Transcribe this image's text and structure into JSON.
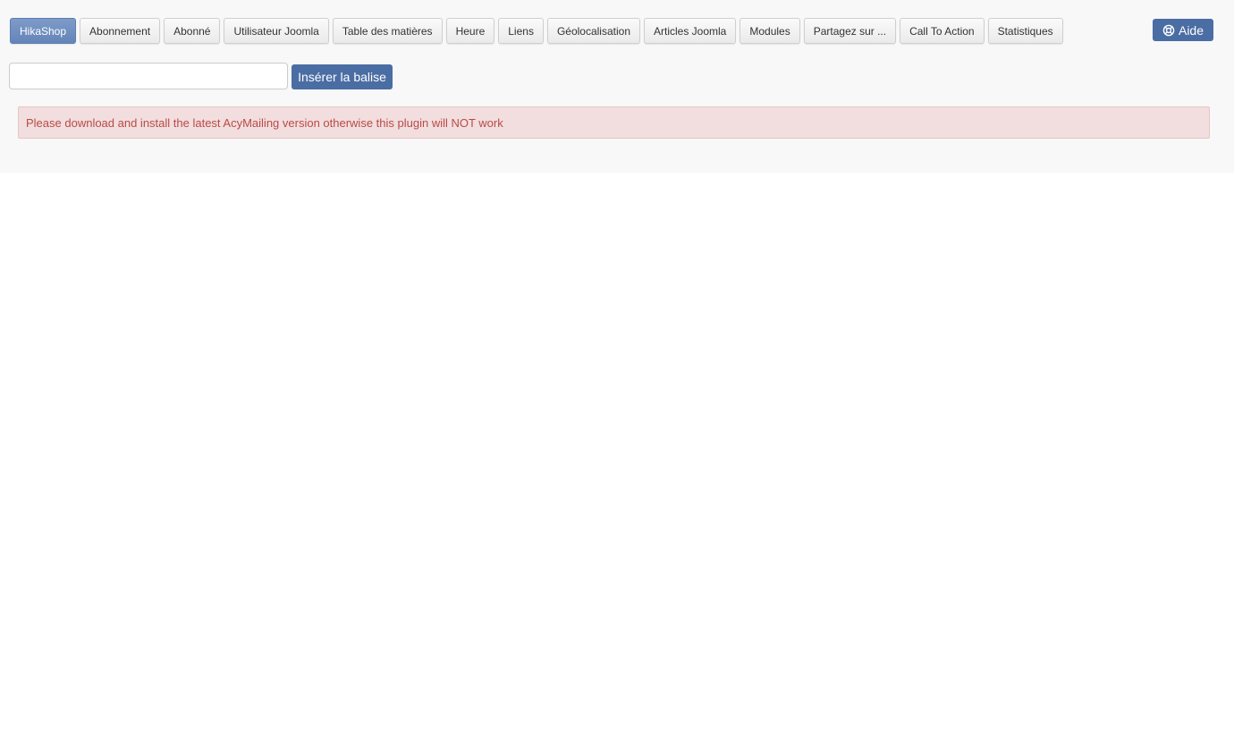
{
  "tabs": [
    {
      "label": "HikaShop",
      "active": true
    },
    {
      "label": "Abonnement"
    },
    {
      "label": "Abonné"
    },
    {
      "label": "Utilisateur Joomla"
    },
    {
      "label": "Table des matières"
    },
    {
      "label": "Heure"
    },
    {
      "label": "Liens"
    },
    {
      "label": "Géolocalisation"
    },
    {
      "label": "Articles Joomla"
    },
    {
      "label": "Modules"
    },
    {
      "label": "Partagez sur ..."
    },
    {
      "label": "Call To Action"
    },
    {
      "label": "Statistiques"
    }
  ],
  "help": {
    "label": "Aide",
    "icon": "lifebuoy-icon"
  },
  "tag_input": {
    "value": "",
    "placeholder": ""
  },
  "insert_button": {
    "label": "Insérer la balise"
  },
  "alert": {
    "message": "Please download and install the latest AcyMailing version otherwise this plugin will NOT work"
  },
  "colors": {
    "accent": "#4a6da4",
    "active_tab": "#6f8ebf",
    "alert_bg": "#f2dede",
    "alert_text": "#b94a48"
  }
}
